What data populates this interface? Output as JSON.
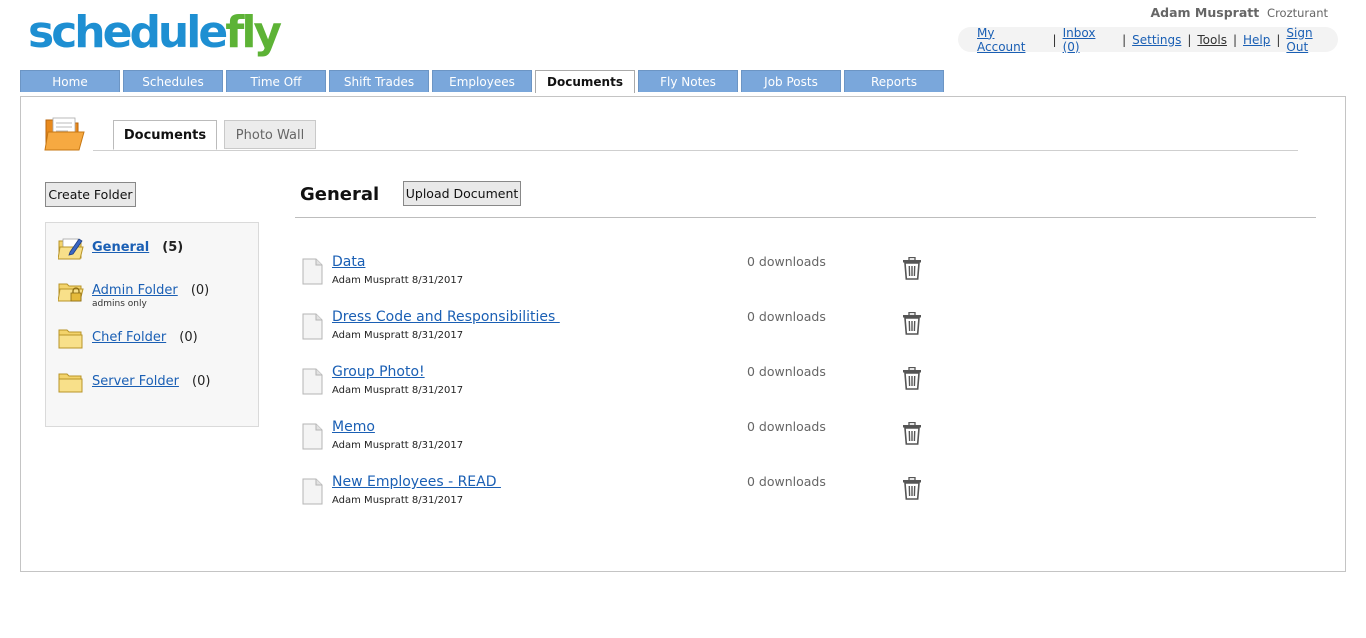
{
  "header": {
    "logo_part1": "schedule",
    "logo_part2": "fly",
    "user_name": "Adam Muspratt",
    "user_org": "Crozturant"
  },
  "account_links": [
    {
      "label": "My Account"
    },
    {
      "label": "Inbox (0)"
    },
    {
      "label": "Settings"
    },
    {
      "label": "Tools"
    },
    {
      "label": "Help"
    },
    {
      "label": "Sign Out"
    }
  ],
  "main_tabs": [
    {
      "label": "Home"
    },
    {
      "label": "Schedules"
    },
    {
      "label": "Time Off"
    },
    {
      "label": "Shift Trades"
    },
    {
      "label": "Employees"
    },
    {
      "label": "Documents",
      "active": true
    },
    {
      "label": "Fly Notes"
    },
    {
      "label": "Job Posts"
    },
    {
      "label": "Reports"
    }
  ],
  "sub_tabs": {
    "documents": "Documents",
    "photo_wall": "Photo Wall"
  },
  "buttons": {
    "create_folder": "Create Folder",
    "upload_document": "Upload Document"
  },
  "folders": [
    {
      "name": "General",
      "count": "(5)",
      "note": "",
      "current": true
    },
    {
      "name": "Admin Folder",
      "count": "(0)",
      "note": "admins only"
    },
    {
      "name": "Chef Folder",
      "count": "(0)",
      "note": ""
    },
    {
      "name": "Server Folder",
      "count": "(0)",
      "note": ""
    }
  ],
  "section": {
    "title": "General"
  },
  "documents": [
    {
      "title": "Data",
      "meta": "Adam Muspratt 8/31/2017",
      "downloads": "0 downloads"
    },
    {
      "title": "Dress Code and Responsibilities ",
      "meta": "Adam Muspratt 8/31/2017",
      "downloads": "0 downloads"
    },
    {
      "title": "Group Photo!",
      "meta": "Adam Muspratt 8/31/2017",
      "downloads": "0 downloads"
    },
    {
      "title": "Memo",
      "meta": "Adam Muspratt 8/31/2017",
      "downloads": "0 downloads"
    },
    {
      "title": "New Employees - READ ",
      "meta": "Adam Muspratt 8/31/2017",
      "downloads": "0 downloads"
    }
  ],
  "colors": {
    "logo_blue": "#1e8fd2",
    "logo_green": "#5db336",
    "tab_blue": "#7aa7db",
    "link_blue": "#1a5fb4"
  }
}
